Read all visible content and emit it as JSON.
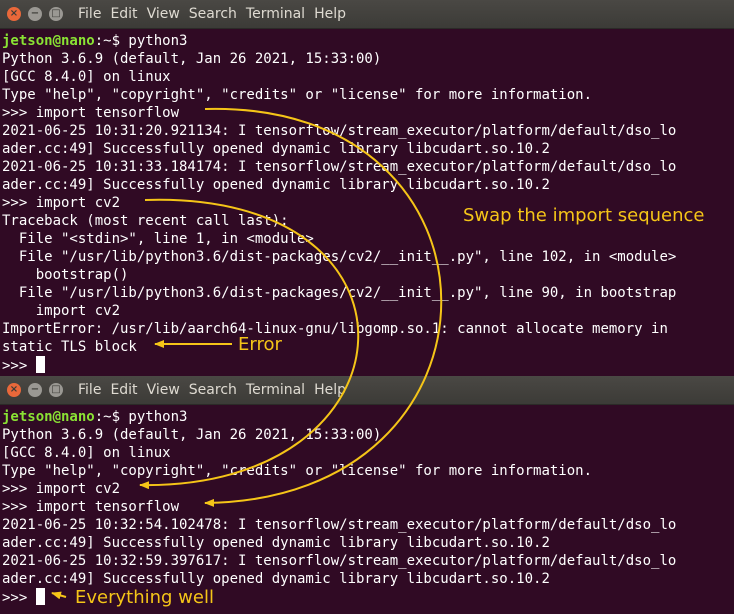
{
  "accent_color": "#f5c518",
  "window_controls": [
    "close-icon",
    "minimize-icon",
    "maximize-icon"
  ],
  "menu": [
    "File",
    "Edit",
    "View",
    "Search",
    "Terminal",
    "Help"
  ],
  "session1": {
    "prompt_user": "jetson@nano",
    "prompt_rest": ":~$ python3",
    "lines": [
      "Python 3.6.9 (default, Jan 26 2021, 15:33:00)",
      "[GCC 8.4.0] on linux",
      "Type \"help\", \"copyright\", \"credits\" or \"license\" for more information.",
      ">>> import tensorflow",
      "2021-06-25 10:31:20.921134: I tensorflow/stream_executor/platform/default/dso_lo",
      "ader.cc:49] Successfully opened dynamic library libcudart.so.10.2",
      "2021-06-25 10:31:33.184174: I tensorflow/stream_executor/platform/default/dso_lo",
      "ader.cc:49] Successfully opened dynamic library libcudart.so.10.2",
      ">>> import cv2",
      "Traceback (most recent call last):",
      "  File \"<stdin>\", line 1, in <module>",
      "  File \"/usr/lib/python3.6/dist-packages/cv2/__init__.py\", line 102, in <module>",
      "    bootstrap()",
      "  File \"/usr/lib/python3.6/dist-packages/cv2/__init__.py\", line 90, in bootstrap",
      "    import cv2",
      "ImportError: /usr/lib/aarch64-linux-gnu/libgomp.so.1: cannot allocate memory in",
      "static TLS block"
    ],
    "final_prompt": ">>> "
  },
  "session2": {
    "prompt_user": "jetson@nano",
    "prompt_rest": ":~$ python3",
    "lines": [
      "Python 3.6.9 (default, Jan 26 2021, 15:33:00)",
      "[GCC 8.4.0] on linux",
      "Type \"help\", \"copyright\", \"credits\" or \"license\" for more information.",
      ">>> import cv2",
      ">>> import tensorflow",
      "2021-06-25 10:32:54.102478: I tensorflow/stream_executor/platform/default/dso_lo",
      "ader.cc:49] Successfully opened dynamic library libcudart.so.10.2",
      "2021-06-25 10:32:59.397617: I tensorflow/stream_executor/platform/default/dso_lo",
      "ader.cc:49] Successfully opened dynamic library libcudart.so.10.2"
    ],
    "final_prompt": ">>> "
  },
  "annotations": {
    "swap": "Swap the import sequence",
    "error": "Error",
    "ok": "Everything well"
  }
}
